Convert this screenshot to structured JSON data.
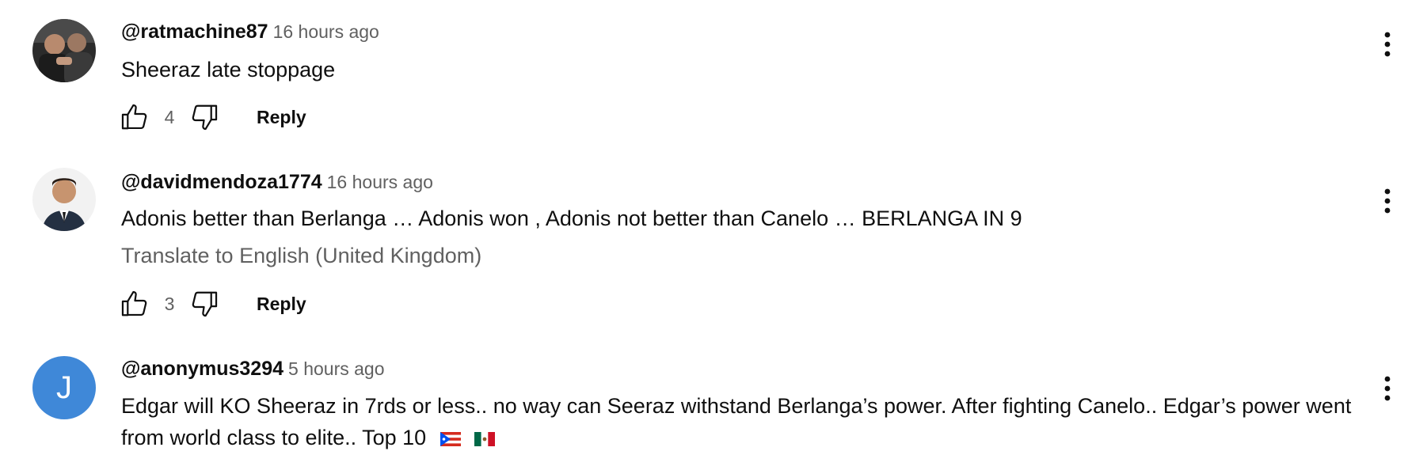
{
  "comments": [
    {
      "author": "@ratmachine87",
      "time": "16 hours ago",
      "text": "Sheeraz late stoppage",
      "likes": "4",
      "reply_label": "Reply"
    },
    {
      "author": "@davidmendoza1774",
      "time": "16 hours ago",
      "text": "Adonis better than Berlanga … Adonis won , Adonis not better than Canelo … BERLANGA IN 9",
      "translate_label": "Translate to English (United Kingdom)",
      "likes": "3",
      "reply_label": "Reply"
    },
    {
      "author": "@anonymus3294",
      "avatar_letter": "J",
      "time": "5 hours ago",
      "text": "Edgar will KO Sheeraz in 7rds or less.. no way can Seeraz withstand Berlanga’s power. After fighting Canelo.. Edgar’s power went from world class to elite.. Top 10",
      "flags": [
        "puerto-rico-flag-icon",
        "mexico-flag-icon"
      ]
    }
  ],
  "colors": {
    "text_primary": "#0f0f0f",
    "text_secondary": "#606060",
    "avatar_blue": "#3f88d8"
  },
  "icons": [
    "thumbs-up-icon",
    "thumbs-down-icon",
    "more-vert-icon"
  ]
}
